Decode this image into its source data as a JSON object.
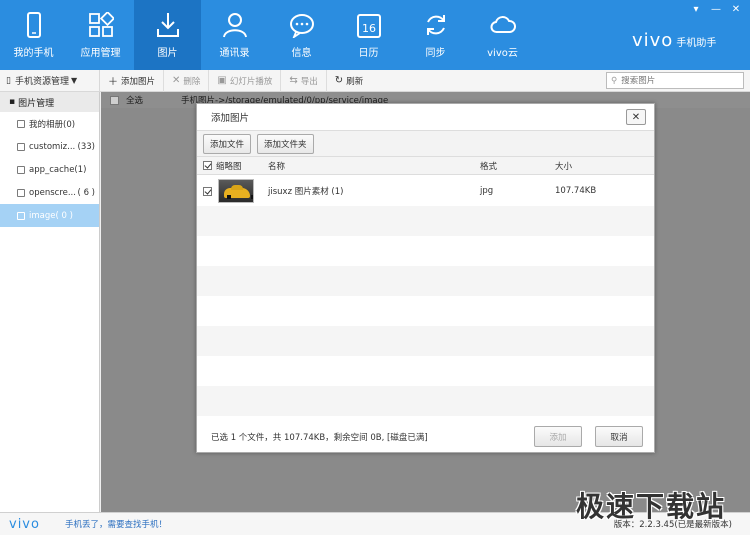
{
  "header": {
    "nav": [
      {
        "label": "我的手机",
        "icon": "phone-icon"
      },
      {
        "label": "应用管理",
        "icon": "apps-icon"
      },
      {
        "label": "图片",
        "icon": "download-image-icon",
        "active": true
      },
      {
        "label": "通讯录",
        "icon": "contact-icon"
      },
      {
        "label": "信息",
        "icon": "message-icon"
      },
      {
        "label": "日历",
        "icon": "calendar-icon",
        "day": "16"
      },
      {
        "label": "同步",
        "icon": "sync-icon"
      },
      {
        "label": "vivo云",
        "icon": "cloud-icon"
      }
    ],
    "brand_logo": "vivo",
    "brand_sub": "手机助手",
    "accent": "#2b8de0"
  },
  "toolbar": {
    "resource_label": "手机资源管理",
    "add_label": "添加图片",
    "delete_label": "删除",
    "slideshow_label": "幻灯片播放",
    "export_label": "导出",
    "refresh_label": "刷新",
    "search_placeholder": "搜索图片"
  },
  "sidebar": {
    "group_label": "图片管理",
    "items": [
      {
        "label": "我的相册(0)",
        "count": ""
      },
      {
        "label": "customiz...",
        "count": "(33)"
      },
      {
        "label": "app_cache(1)",
        "count": ""
      },
      {
        "label": "openscre...",
        "count": "( 6 )"
      },
      {
        "label": "image( 0 )",
        "count": "",
        "active": true
      }
    ]
  },
  "main": {
    "select_all": "全选",
    "path": "手机图片->/storage/emulated/0/pp/service/image"
  },
  "modal": {
    "title": "添加图片",
    "close": "✕",
    "add_file": "添加文件",
    "add_folder": "添加文件夹",
    "columns": {
      "thumb": "缩略图",
      "name": "名称",
      "format": "格式",
      "size": "大小"
    },
    "files": [
      {
        "name": "jisuxz 图片素材 (1)",
        "format": "jpg",
        "size": "107.74KB"
      }
    ],
    "summary": "已选 1 个文件，共 107.74KB，剩余空间 0B, [磁盘已满]",
    "add_btn": "添加",
    "cancel_btn": "取消"
  },
  "status": {
    "logo": "vivo",
    "link": "手机丢了，需要查找手机！",
    "version": "版本：2.2.3.45(已是最新版本)",
    "watermark": "极速下载站"
  }
}
